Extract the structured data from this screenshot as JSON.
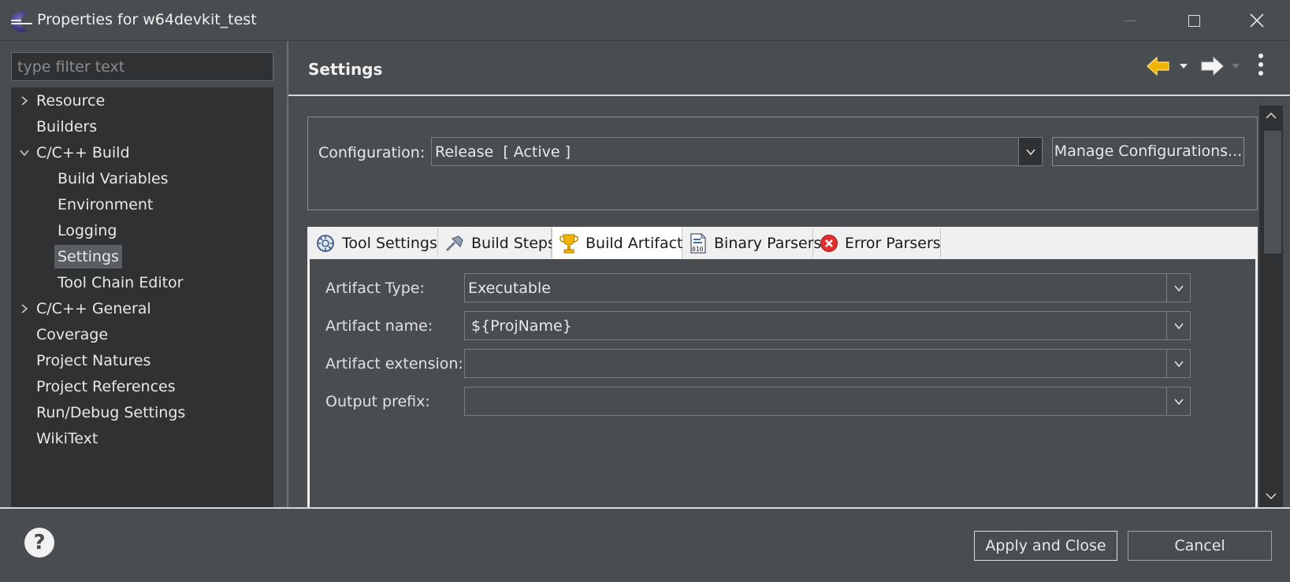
{
  "window": {
    "title": "Properties for w64devkit_test"
  },
  "left": {
    "filter_placeholder": "type filter text",
    "tree": [
      {
        "label": "Resource",
        "indent": 0,
        "expander": "collapsed"
      },
      {
        "label": "Builders",
        "indent": 0,
        "expander": "none"
      },
      {
        "label": "C/C++ Build",
        "indent": 0,
        "expander": "expanded"
      },
      {
        "label": "Build Variables",
        "indent": 1,
        "expander": "none"
      },
      {
        "label": "Environment",
        "indent": 1,
        "expander": "none"
      },
      {
        "label": "Logging",
        "indent": 1,
        "expander": "none"
      },
      {
        "label": "Settings",
        "indent": 1,
        "expander": "none",
        "selected": true
      },
      {
        "label": "Tool Chain Editor",
        "indent": 1,
        "expander": "none"
      },
      {
        "label": "C/C++ General",
        "indent": 0,
        "expander": "collapsed"
      },
      {
        "label": "Coverage",
        "indent": 0,
        "expander": "none"
      },
      {
        "label": "Project Natures",
        "indent": 0,
        "expander": "none"
      },
      {
        "label": "Project References",
        "indent": 0,
        "expander": "none"
      },
      {
        "label": "Run/Debug Settings",
        "indent": 0,
        "expander": "none"
      },
      {
        "label": "WikiText",
        "indent": 0,
        "expander": "none"
      }
    ]
  },
  "right": {
    "title": "Settings",
    "configuration": {
      "label": "Configuration:",
      "value": "Release  [ Active ]",
      "manage_label": "Manage Configurations..."
    },
    "tabs": [
      {
        "label": "Tool Settings",
        "icon": "tool-settings-icon"
      },
      {
        "label": "Build Steps",
        "icon": "build-steps-icon"
      },
      {
        "label": "Build Artifact",
        "icon": "trophy-icon",
        "active": true
      },
      {
        "label": "Binary Parsers",
        "icon": "binary-parsers-icon"
      },
      {
        "label": "Error Parsers",
        "icon": "error-icon"
      }
    ],
    "fields": [
      {
        "label": "Artifact Type:",
        "value": "Executable"
      },
      {
        "label": "Artifact name:",
        "value": "${ProjName}"
      },
      {
        "label": "Artifact extension:",
        "value": ""
      },
      {
        "label": "Output prefix:",
        "value": ""
      }
    ]
  },
  "footer": {
    "apply_label": "Apply and Close",
    "cancel_label": "Cancel"
  },
  "colors": {
    "background": "#4a4d50",
    "tree_background": "#2f3133",
    "accent_back_arrow": "#f0b400"
  }
}
